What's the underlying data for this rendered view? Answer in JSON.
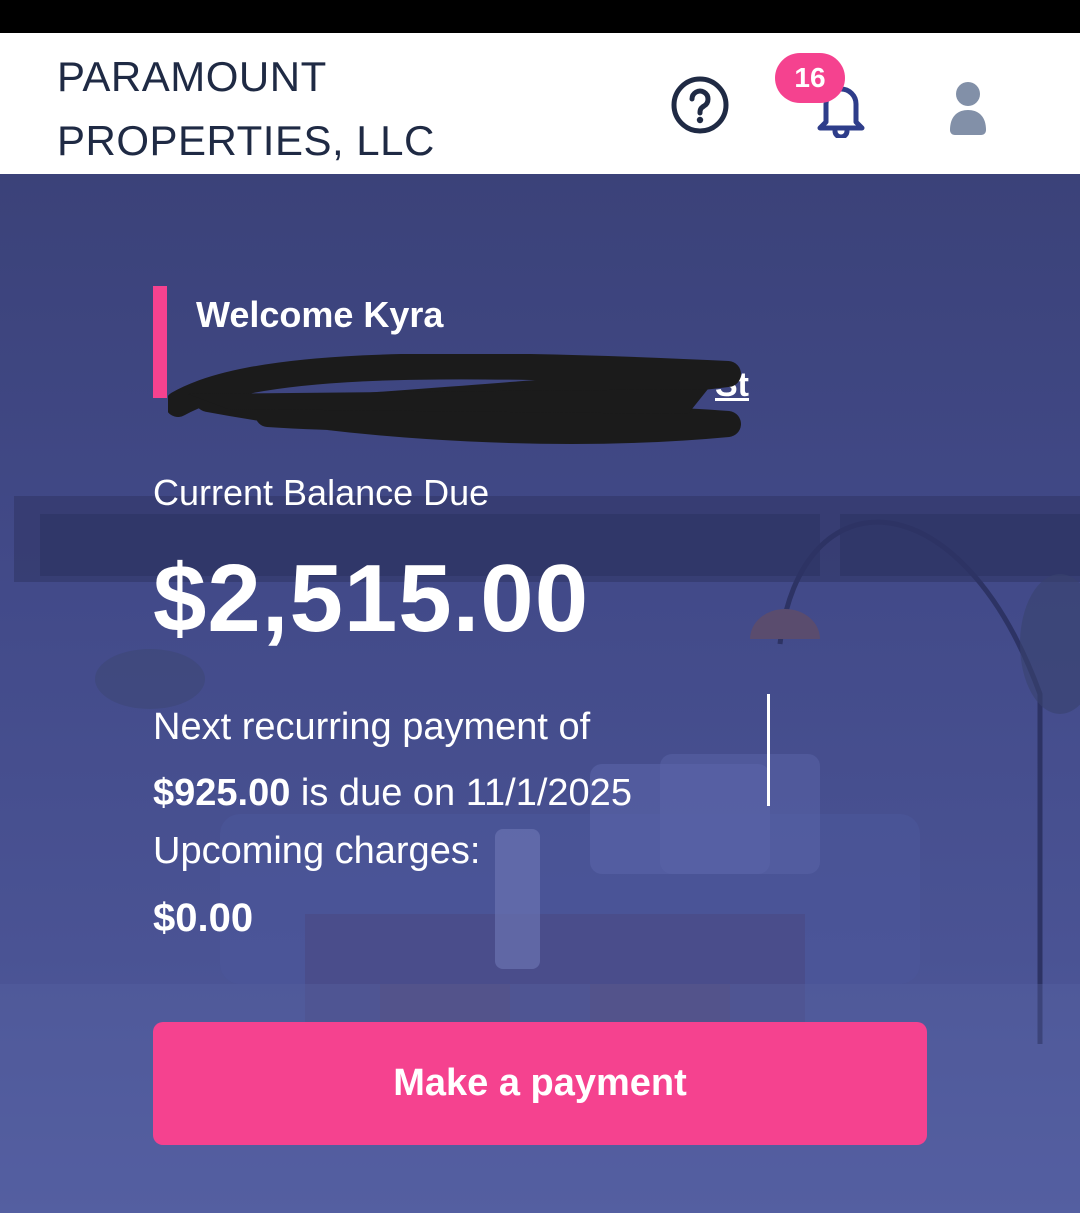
{
  "status_bar": {},
  "header": {
    "brand_line1": "PARAMOUNT",
    "brand_line2": "PROPERTIES, LLC",
    "notification_count": "16",
    "icons": [
      "help-circle-icon",
      "bell-icon",
      "user-icon"
    ]
  },
  "hero": {
    "welcome": "Welcome Kyra",
    "address_visible_suffix": "St",
    "balance_label": "Current Balance Due",
    "balance_amount": "$2,515.00",
    "recurring_prefix": "Next recurring payment of",
    "recurring_amount": "$925.00",
    "recurring_suffix": " is due on 11/1/2025",
    "upcoming_label": "Upcoming charges:",
    "upcoming_amount": "$0.00",
    "pay_button": "Make a payment"
  },
  "colors": {
    "accent": "#f5428f",
    "hero_bg": "#424a89",
    "header_text": "#1f2a44"
  }
}
